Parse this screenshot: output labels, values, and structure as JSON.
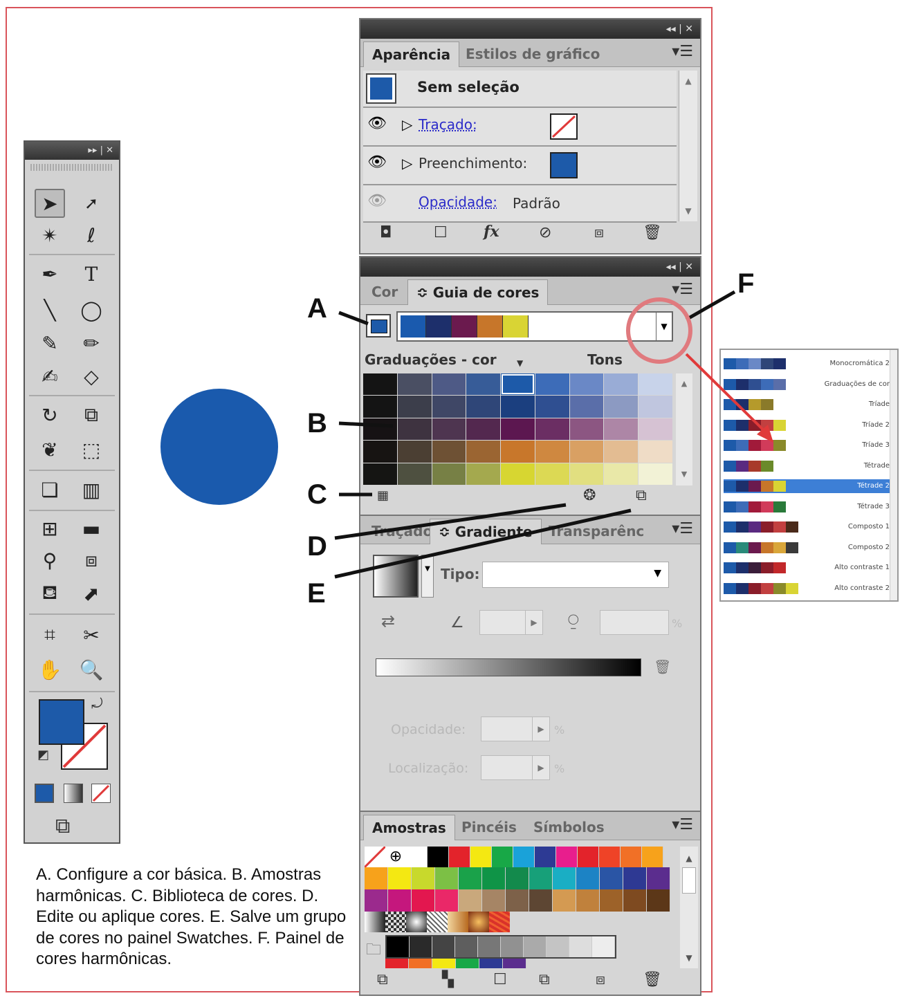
{
  "appearance_panel": {
    "tabs": [
      "Aparência",
      "Estilos de gráfico"
    ],
    "header": "Sem seleção",
    "rows": [
      {
        "label": "Traçado:"
      },
      {
        "label": "Preenchimento:"
      },
      {
        "label": "Opacidade:",
        "value": "Padrão"
      }
    ]
  },
  "color_guide_panel": {
    "tabs": [
      "Cor",
      "≎ Guia de cores"
    ],
    "harmony_colors": [
      "#1a5aae",
      "#1d2f6b",
      "#6b1a4e",
      "#c7762a",
      "#d9d434"
    ],
    "graduations_label": "Graduações - cor",
    "tons_label": "Tons",
    "grid": [
      [
        "#141414",
        "#4a4f63",
        "#4e5a86",
        "#375c98",
        "#1d5aa9",
        "#3d6cb8",
        "#6a88c6",
        "#99acd6",
        "#c8d3ea"
      ],
      [
        "#141414",
        "#3c3e4b",
        "#3f4766",
        "#2f4678",
        "#1b3f7f",
        "#2f4f91",
        "#5a6ea9",
        "#8c9ac2",
        "#c0c6df"
      ],
      [
        "#161214",
        "#3e3340",
        "#4e3550",
        "#53284f",
        "#5c1750",
        "#6b2e63",
        "#8c5682",
        "#ad86a6",
        "#d6c2d3"
      ],
      [
        "#171412",
        "#4b3f33",
        "#6e5134",
        "#9b6532",
        "#c8772b",
        "#cf8840",
        "#d9a063",
        "#e3bc92",
        "#efdcc6"
      ],
      [
        "#151513",
        "#4e5040",
        "#778045",
        "#a4a94e",
        "#d7d631",
        "#dcd954",
        "#e1df80",
        "#e9e8a8",
        "#f2f2d6"
      ]
    ],
    "harmony_list": [
      {
        "name": "Monocromática 2",
        "colors": [
          "#1d5aa9",
          "#3d6cb8",
          "#6a88c6",
          "#2f4678",
          "#1d2f6b"
        ]
      },
      {
        "name": "Graduações de cor",
        "colors": [
          "#1d5aa9",
          "#1d2f6b",
          "#2f4f91",
          "#3d6cb8",
          "#5a6ea9"
        ]
      },
      {
        "name": "Tríade",
        "colors": [
          "#1d5aa9",
          "#1d2f6b",
          "#b59a2b",
          "#8a7a2a"
        ]
      },
      {
        "name": "Tríade 2",
        "colors": [
          "#1d5aa9",
          "#1d2f6b",
          "#8a1d2a",
          "#c24040",
          "#d9d434"
        ]
      },
      {
        "name": "Tríade 3",
        "colors": [
          "#1d5aa9",
          "#3d6cb8",
          "#a11a3a",
          "#d13b5a",
          "#8a8a2a"
        ]
      },
      {
        "name": "Tétrade",
        "colors": [
          "#1d5aa9",
          "#5a2a80",
          "#a83a2a",
          "#6a8a2a"
        ]
      },
      {
        "name": "Tétrade 2",
        "colors": [
          "#1d5aa9",
          "#1d2f6b",
          "#6b1a4e",
          "#c7762a",
          "#d9d434"
        ]
      },
      {
        "name": "Tétrade 3",
        "colors": [
          "#1d5aa9",
          "#3d6cb8",
          "#a11a3a",
          "#d13b5a",
          "#2a7a3a"
        ]
      },
      {
        "name": "Composto 1",
        "colors": [
          "#1d5aa9",
          "#1d2f6b",
          "#5a2a80",
          "#8a1d2a",
          "#c24040",
          "#4a2a1a"
        ]
      },
      {
        "name": "Composto 2",
        "colors": [
          "#1d5aa9",
          "#2a8a7a",
          "#6b1a4e",
          "#c7762a",
          "#d9a63a",
          "#3a3a3a"
        ]
      },
      {
        "name": "Alto contraste 1",
        "colors": [
          "#1d5aa9",
          "#1d2f6b",
          "#3a1d3a",
          "#8a1d2a",
          "#c2282a"
        ]
      },
      {
        "name": "Alto contraste 2",
        "colors": [
          "#1d5aa9",
          "#1d2f6b",
          "#8a1d2a",
          "#c24040",
          "#8a8a2a",
          "#d9d434"
        ]
      }
    ]
  },
  "gradient_panel": {
    "tabs": [
      "Traçado",
      "≎ Gradiente",
      "Transparênc"
    ],
    "type_label": "Tipo:",
    "opacity_label": "Opacidade:",
    "location_label": "Localização:",
    "percent": "%"
  },
  "swatches_panel": {
    "tabs": [
      "Amostras",
      "Pincéis",
      "Símbolos"
    ],
    "row1": [
      "#ffffff",
      "#000000",
      "#e3232b",
      "#f4e812",
      "#18a847",
      "#1aa2d9",
      "#2d3a94",
      "#e81e8d",
      "#e3232b",
      "#ef4327",
      "#f17026",
      "#f7a21b"
    ],
    "row2": [
      "#f7a21b",
      "#f4e812",
      "#c8d92c",
      "#7cc045",
      "#1aa24a",
      "#0f9447",
      "#138a4c",
      "#17a079",
      "#1aaec4",
      "#1c83c5",
      "#2a55a5",
      "#2e3993",
      "#5b2d8e"
    ],
    "row3": [
      "#9b2a8d",
      "#c5177d",
      "#e3174f",
      "#ea2868",
      "#c9a87c",
      "#a68565",
      "#7d6149",
      "#5d4633",
      "#d49a52",
      "#c0813c",
      "#9d6229",
      "#7e4a20",
      "#5c3718"
    ],
    "greys": [
      "#000000",
      "#2a2a2a",
      "#444444",
      "#5e5e5e",
      "#777777",
      "#919191",
      "#aaaaaa",
      "#c4c4c4",
      "#dddddd",
      "#ededed"
    ],
    "row5": [
      "#e3232b",
      "#f17026",
      "#f4e812",
      "#18a847",
      "#2d3a94",
      "#5b2d8e"
    ]
  },
  "callouts": [
    "A",
    "B",
    "C",
    "D",
    "E",
    "F"
  ],
  "caption": "A. Configure a cor básica. B. Amostras harmônicas. C. Biblioteca de cores. D. Edite ou aplique cores. E. Salve um grupo de cores no painel Swatches. F. Painel de cores harmônicas.",
  "colors": {
    "fill": "#1d5aa9",
    "accent_red": "#e03a3a",
    "frame": "#d9545a"
  }
}
